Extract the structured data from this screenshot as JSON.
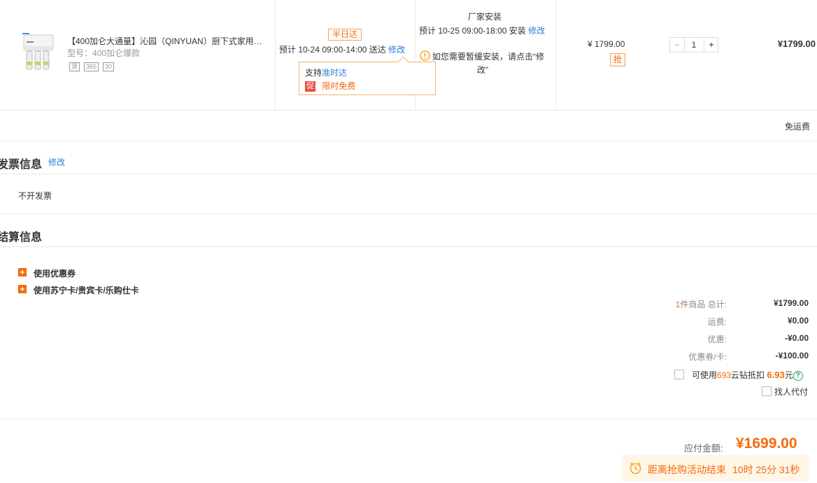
{
  "product": {
    "name": "【400加仑大通量】沁园（QINYUAN）厨下式家用…",
    "model": "型号：400加仑爆款",
    "tags": [
      "退",
      "365",
      "30"
    ],
    "price": "¥ 1799.00",
    "qiang": "抢",
    "quantity": "1",
    "minus": "−",
    "plus": "+",
    "subtotal": "¥1799.00"
  },
  "delivery": {
    "badge": "半日达",
    "estimate": "预计 10-24 09:00-14:00 送达",
    "modify": "修改",
    "promo_prefix": "支持",
    "promo_link": "准时达",
    "promo_badge": "促",
    "promo_text": "限时免费"
  },
  "install": {
    "title": "厂家安装",
    "estimate": "预计 10-25 09:00-18:00 安装",
    "modify": "修改",
    "notice_line1": "如您需要暂缓安装，请点击“修",
    "notice_line2": "改”"
  },
  "shipping_note": "免运费",
  "invoice": {
    "title": "发票信息",
    "modify": "修改",
    "value": "不开发票"
  },
  "settlement": {
    "title": "结算信息",
    "options": [
      "使用优惠券",
      "使用苏宁卡/贵宾卡/乐购仕卡"
    ],
    "count_num": "1",
    "count_label": "件商品 总计:",
    "total": "¥1799.00",
    "shipping_label": "运费:",
    "shipping": "¥0.00",
    "discount_label": "优惠:",
    "discount": "-¥0.00",
    "coupon_label": "优惠券/卡:",
    "coupon": "-¥100.00",
    "diamond_pre": "可使用",
    "diamond_num": "693",
    "diamond_mid": "云钻抵扣",
    "diamond_amount": "6.93",
    "diamond_unit": "元",
    "help": "?",
    "proxy_pay": "找人代付"
  },
  "payable": {
    "label": "应付金额:",
    "amount": "¥1699.00"
  },
  "countdown": {
    "text": "距离抢购活动结束",
    "time": "10时 25分 31秒"
  },
  "colors": {
    "accent": "#f56a0a",
    "link": "#2d7bd6",
    "border": "#e8e8e8"
  }
}
